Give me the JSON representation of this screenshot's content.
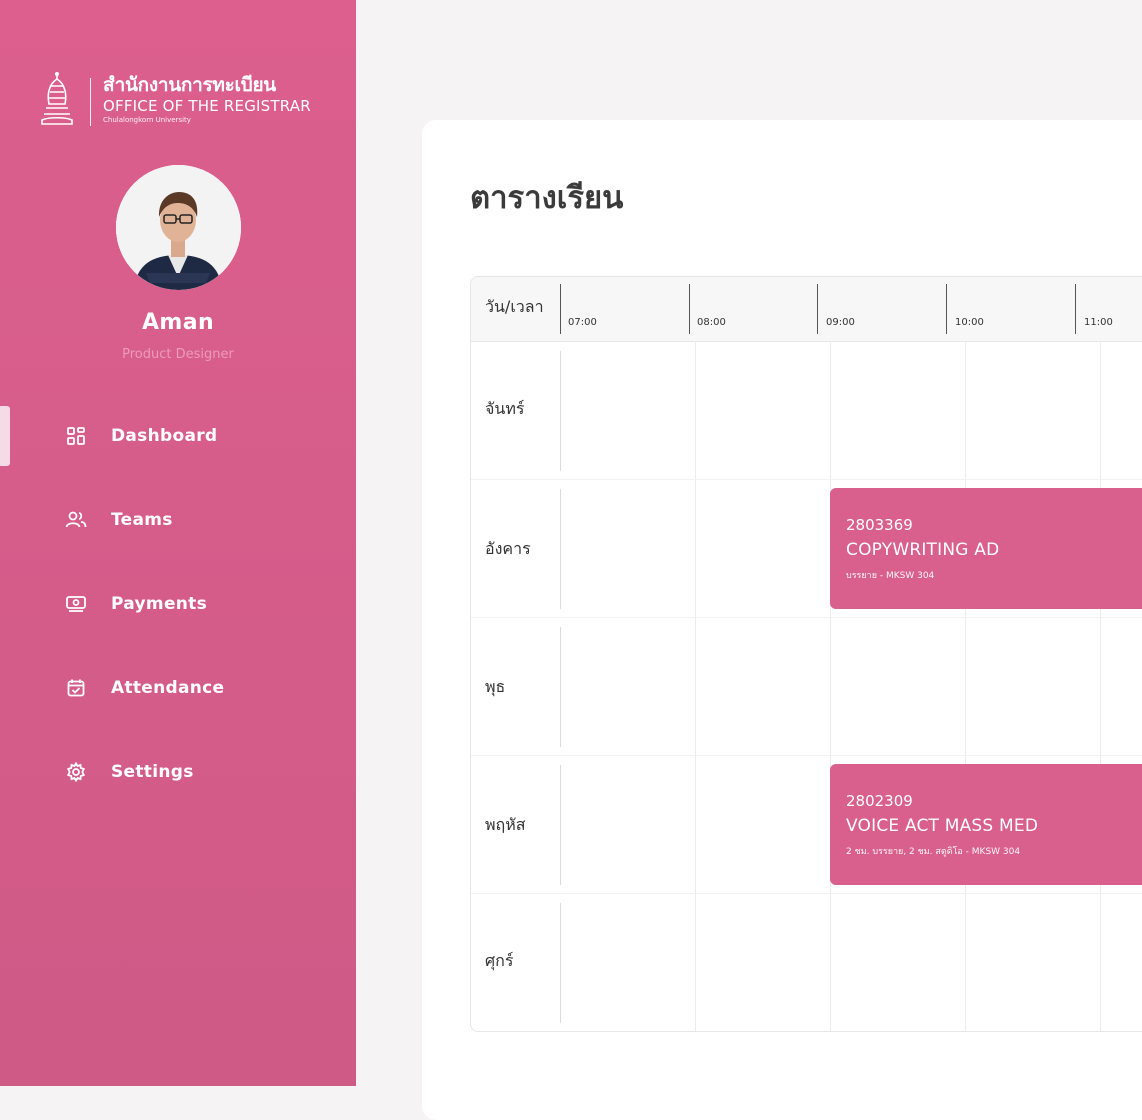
{
  "brand": {
    "thai_name": "สำนักงานการทะเบียน",
    "english_name": "OFFICE OF THE REGISTRAR",
    "university": "Chulalongkorn University"
  },
  "profile": {
    "name": "Aman",
    "role": "Product Designer"
  },
  "nav": {
    "items": [
      {
        "label": "Dashboard",
        "icon": "dashboard-icon",
        "active": true
      },
      {
        "label": "Teams",
        "icon": "teams-icon"
      },
      {
        "label": "Payments",
        "icon": "payments-icon"
      },
      {
        "label": "Attendance",
        "icon": "attendance-icon"
      },
      {
        "label": "Settings",
        "icon": "settings-icon"
      }
    ]
  },
  "page": {
    "title": "ตารางเรียน"
  },
  "schedule": {
    "corner_label": "วัน/เวลา",
    "times": [
      "07:00",
      "08:00",
      "09:00",
      "10:00",
      "11:00"
    ],
    "days": [
      "จันทร์",
      "อังคาร",
      "พุธ",
      "พฤหัส",
      "ศุกร์"
    ],
    "events": [
      {
        "code": "2803369",
        "title": "COPYWRITING AD",
        "detail": "บรรยาย - MKSW 304",
        "day": "อังคาร",
        "start": "09:00"
      },
      {
        "code": "2802309",
        "title": "VOICE ACT MASS MED",
        "detail": "2 ชม. บรรยาย, 2 ชม. สตูดิโอ - MKSW 304",
        "day": "พฤหัส",
        "start": "09:00"
      }
    ]
  },
  "colors": {
    "sidebar": "#dc5f8d",
    "accent": "#d95f8c",
    "background": "#f5f3f4"
  }
}
